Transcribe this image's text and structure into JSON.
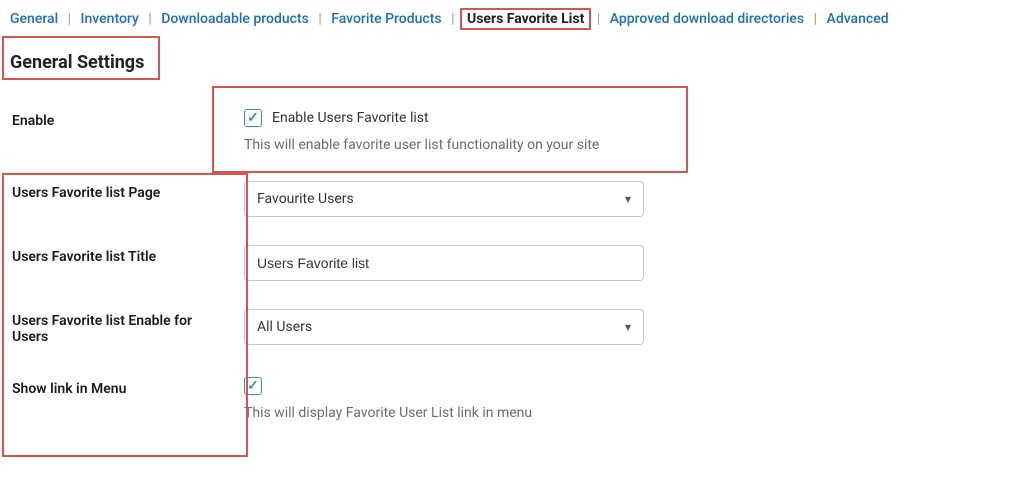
{
  "tabs": {
    "general": "General",
    "inventory": "Inventory",
    "downloadable": "Downloadable products",
    "favorite_products": "Favorite Products",
    "users_favorite_list": "Users Favorite List",
    "approved_dirs": "Approved download directories",
    "advanced": "Advanced"
  },
  "page_title": "General Settings",
  "rows": {
    "enable": {
      "label": "Enable",
      "chk_label": "Enable Users Favorite list",
      "desc": "This will enable favorite user list functionality on your site",
      "checked": "✓"
    },
    "page_select": {
      "label": "Users Favorite list Page",
      "value": "Favourite Users"
    },
    "title_input": {
      "label": "Users Favorite list Title",
      "value": "Users Favorite list"
    },
    "enable_for": {
      "label": "Users Favorite list Enable for Users",
      "value": "All Users"
    },
    "show_link": {
      "label": "Show link in Menu",
      "checked": "✓",
      "desc": "This will display Favorite User List link in menu"
    }
  }
}
